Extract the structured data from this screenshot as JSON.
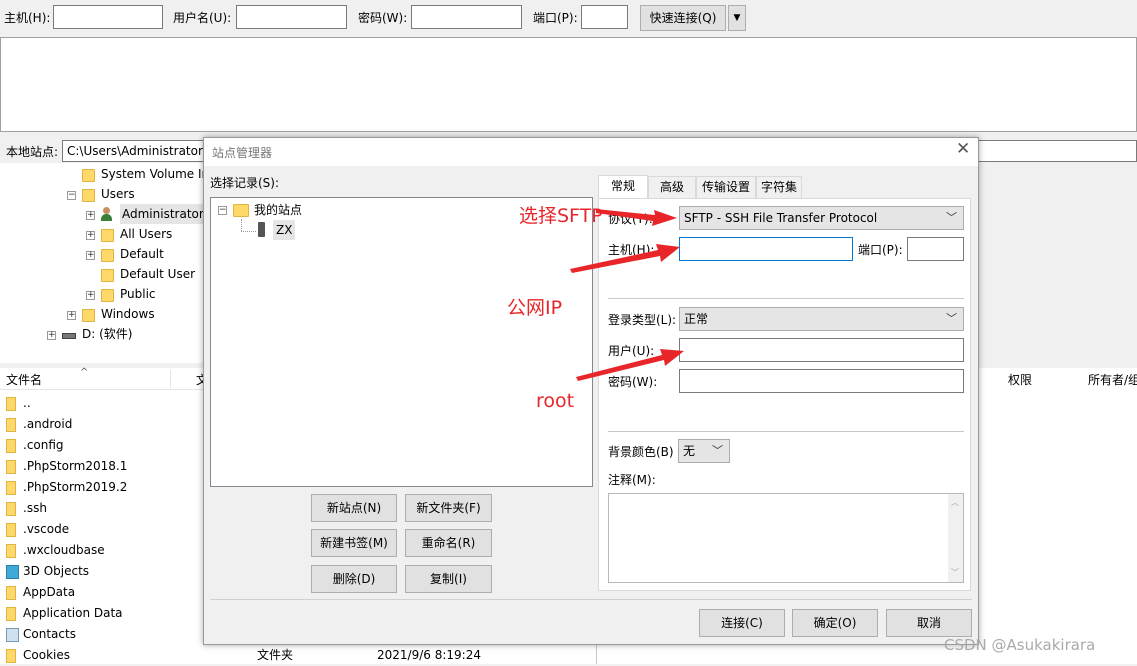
{
  "quickconnect": {
    "host_label": "主机(H):",
    "user_label": "用户名(U):",
    "pass_label": "密码(W):",
    "port_label": "端口(P):",
    "connect_button": "快速连接(Q)"
  },
  "local": {
    "site_label": "本地站点:",
    "path_value": "C:\\Users\\Administrator\\",
    "tree": [
      {
        "label": "System Volume In"
      },
      {
        "label": "Users"
      },
      {
        "label": "Administrator"
      },
      {
        "label": "All Users"
      },
      {
        "label": "Default"
      },
      {
        "label": "Default User"
      },
      {
        "label": "Public"
      },
      {
        "label": "Windows"
      },
      {
        "label": "D: (软件)"
      }
    ],
    "file_header": {
      "name": "文件名",
      "col2": "文",
      "perm": "权限",
      "owner": "所有者/组"
    },
    "files": [
      {
        "name": ".."
      },
      {
        "name": ".android"
      },
      {
        "name": ".config"
      },
      {
        "name": ".PhpStorm2018.1"
      },
      {
        "name": ".PhpStorm2019.2"
      },
      {
        "name": ".ssh"
      },
      {
        "name": ".vscode"
      },
      {
        "name": ".wxcloudbase"
      },
      {
        "name": "3D Objects"
      },
      {
        "name": "AppData"
      },
      {
        "name": "Application Data"
      },
      {
        "name": "Contacts"
      },
      {
        "name": "Cookies",
        "type": "文件夹",
        "modified": "2021/9/6 8:19:24"
      }
    ]
  },
  "dialog": {
    "title": "站点管理器",
    "select_entry_label": "选择记录(S):",
    "tree_root": "我的站点",
    "tree_child": "ZX",
    "buttons": {
      "new_site": "新站点(N)",
      "new_folder": "新文件夹(F)",
      "new_bookmark": "新建书签(M)",
      "rename": "重命名(R)",
      "delete": "删除(D)",
      "copy": "复制(I)",
      "connect": "连接(C)",
      "ok": "确定(O)",
      "cancel": "取消"
    },
    "tabs": [
      "常规",
      "高级",
      "传输设置",
      "字符集"
    ],
    "general": {
      "protocol_label": "协议(T):",
      "protocol_value": "SFTP - SSH File Transfer Protocol",
      "host_label": "主机(H):",
      "port_label": "端口(P):",
      "logon_type_label": "登录类型(L):",
      "logon_type_value": "正常",
      "user_label": "用户(U):",
      "password_label": "密码(W):",
      "bg_color_label": "背景颜色(B)",
      "bg_color_value": "无",
      "comments_label": "注释(M):"
    }
  },
  "annotations": {
    "select_sftp": "选择SFTP",
    "public_ip": "公网IP",
    "root": "root"
  },
  "watermark": "CSDN @Asukakirara",
  "colors": {
    "annotation": "#e8262a",
    "input_focus": "#0078d7"
  }
}
